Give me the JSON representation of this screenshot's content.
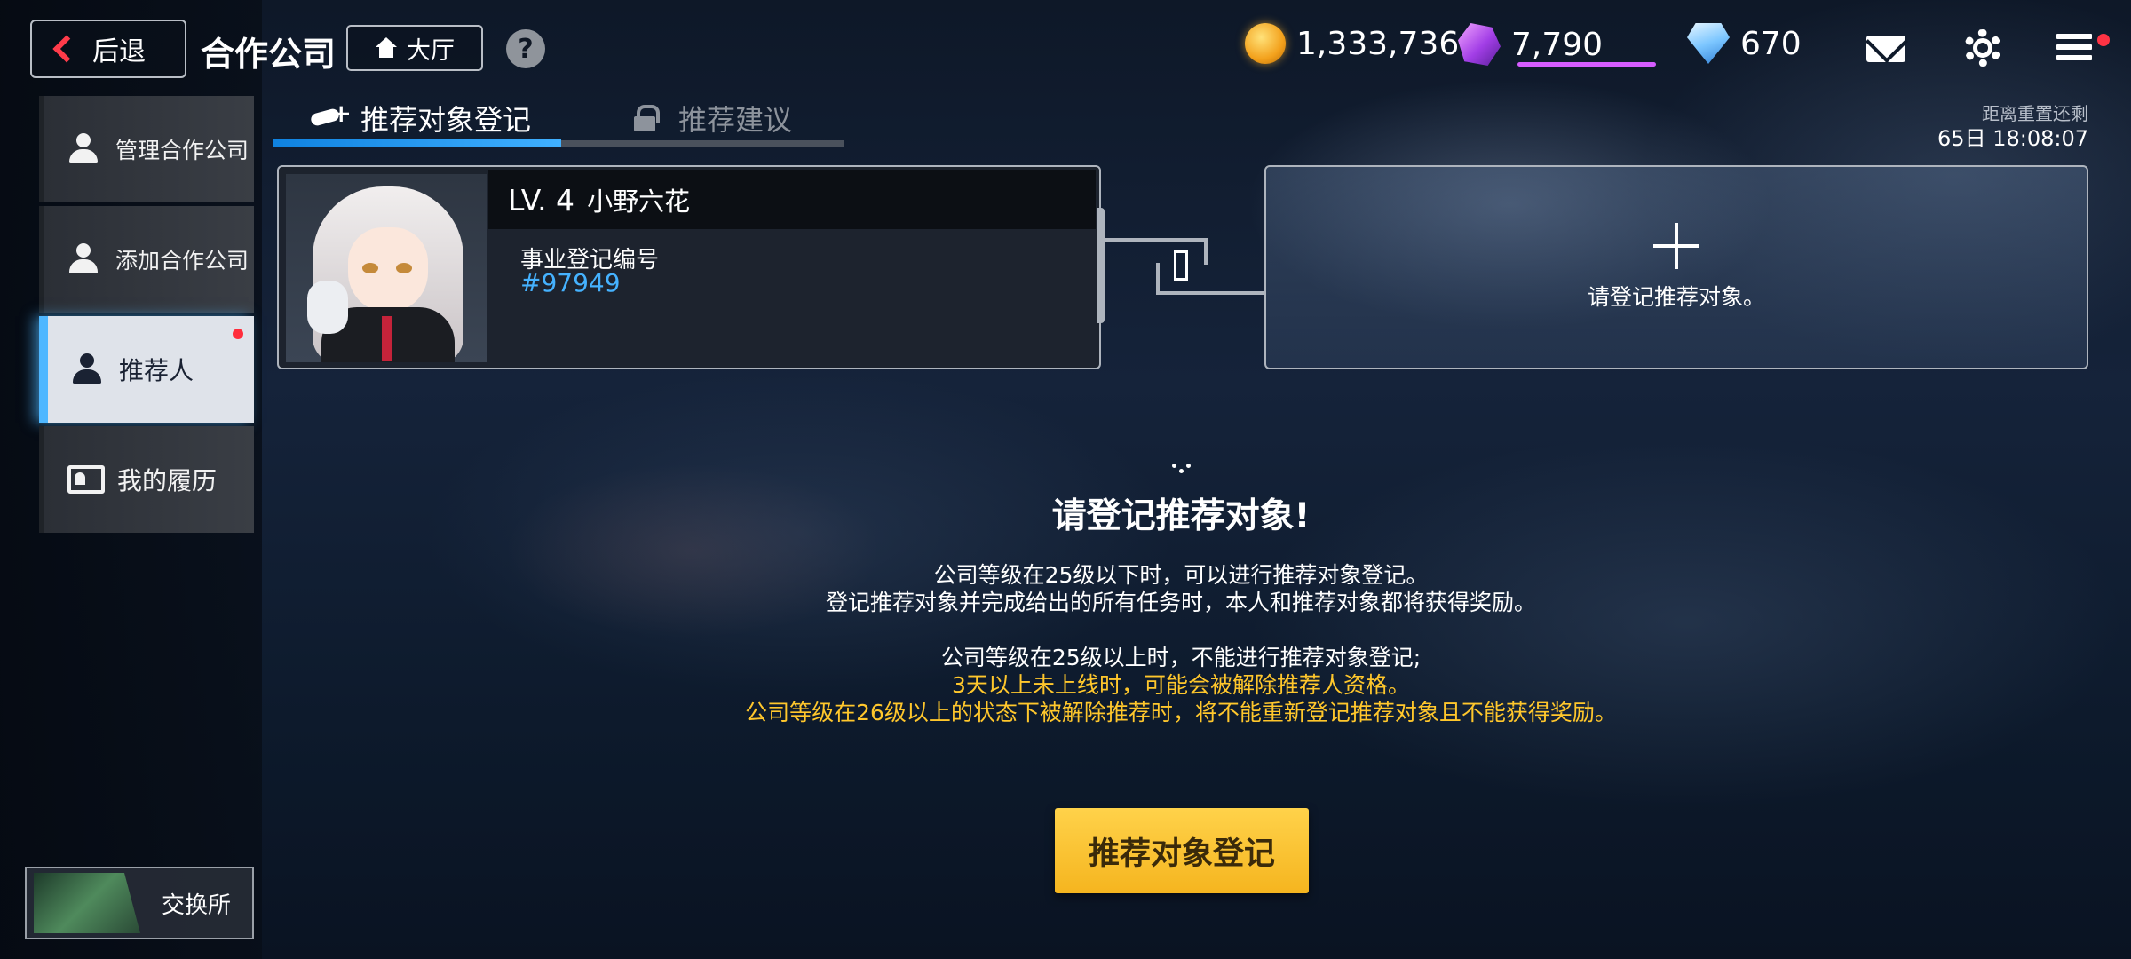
{
  "header": {
    "back_label": "后退",
    "title": "合作公司",
    "lobby_label": "大厅",
    "help_glyph": "?",
    "currencies": [
      {
        "name": "gold-coin",
        "value": "1,333,736",
        "color": "#f3a11c"
      },
      {
        "name": "crystal",
        "value": "7,790",
        "color": "#a23ee6"
      },
      {
        "name": "diamond",
        "value": "670",
        "color": "#7cc6ff"
      }
    ]
  },
  "sidebar": {
    "items": [
      {
        "label": "管理合作公司",
        "icon": "people-icon",
        "active": false
      },
      {
        "label": "添加合作公司",
        "icon": "add-person-icon",
        "active": false
      },
      {
        "label": "推荐人",
        "icon": "recommender-icon",
        "active": true,
        "has_notification": true
      },
      {
        "label": "我的履历",
        "icon": "resume-icon",
        "active": false
      }
    ],
    "exchange_label": "交换所"
  },
  "tabs": [
    {
      "label": "推荐对象登记",
      "icon": "handshake-icon",
      "active": true
    },
    {
      "label": "推荐建议",
      "icon": "lock-icon",
      "locked": true
    }
  ],
  "reset": {
    "label": "距离重置还剩",
    "time": "65日  18:08:07"
  },
  "profile": {
    "level": "LV. 4",
    "name": "小野六花",
    "reg_label": "事业登记编号",
    "reg_number": "#97949"
  },
  "slot": {
    "text": "请登记推荐对象。"
  },
  "info": {
    "title": "请登记推荐对象!",
    "line1": "公司等级在25级以下时，可以进行推荐对象登记。",
    "line2": "登记推荐对象并完成给出的所有任务时，本人和推荐对象都将获得奖励。",
    "line3": "公司等级在25级以上时，不能进行推荐对象登记;",
    "warning1": "3天以上未上线时，可能会被解除推荐人资格。",
    "warning2": "公司等级在26级以上的状态下被解除推荐时，将不能重新登记推荐对象且不能获得奖励。"
  },
  "register_button": "推荐对象登记",
  "colors": {
    "accent_blue": "#40b0ff",
    "warning_yellow": "#ffc72c",
    "button_yellow": "#f5b51f",
    "notification_red": "#ff2d3c"
  }
}
